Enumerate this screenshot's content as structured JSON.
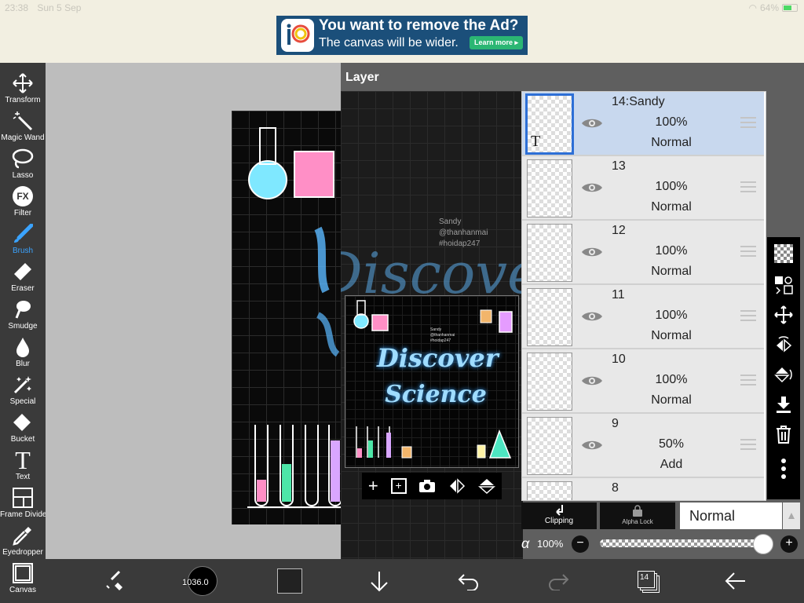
{
  "status": {
    "time": "23:38",
    "date": "Sun 5 Sep",
    "battery": "64%"
  },
  "ad": {
    "line1": "You want to remove the Ad?",
    "line2": "The canvas will be wider.",
    "button": "Learn more ▸"
  },
  "tools": [
    {
      "label": "Transform"
    },
    {
      "label": "Magic Wand"
    },
    {
      "label": "Lasso"
    },
    {
      "label": "Filter"
    },
    {
      "label": "Brush"
    },
    {
      "label": "Eraser"
    },
    {
      "label": "Smudge"
    },
    {
      "label": "Blur"
    },
    {
      "label": "Special"
    },
    {
      "label": "Bucket"
    },
    {
      "label": "Text"
    },
    {
      "label": "Frame Divider"
    },
    {
      "label": "Eyedropper"
    },
    {
      "label": "Canvas"
    }
  ],
  "filter_icon_text": "FX",
  "text_icon_text": "T",
  "layer_panel": {
    "title": "Layer"
  },
  "art_text": {
    "credit1": "Sandy",
    "credit2": "@thanhanmai",
    "credit3": "#hoidap247",
    "word1": "Discover",
    "word2": "Science"
  },
  "layers": [
    {
      "name": "14:Sandy",
      "opacity": "100%",
      "mode": "Normal",
      "selected": true
    },
    {
      "name": "13",
      "opacity": "100%",
      "mode": "Normal"
    },
    {
      "name": "12",
      "opacity": "100%",
      "mode": "Normal"
    },
    {
      "name": "11",
      "opacity": "100%",
      "mode": "Normal"
    },
    {
      "name": "10",
      "opacity": "100%",
      "mode": "Normal"
    },
    {
      "name": "9",
      "opacity": "50%",
      "mode": "Add"
    },
    {
      "name": "8"
    }
  ],
  "layer_thumb_letter": "T",
  "clipping_label": "Clipping",
  "alpha_lock_label": "Alpha Lock",
  "blend_mode": "Normal",
  "alpha": {
    "symbol": "α",
    "value": "100%"
  },
  "bottom": {
    "brush_size": "1036.0",
    "layer_count": "14"
  },
  "colors": {
    "accent": "#3aa3ff",
    "toolbar": "#3a3a3a",
    "selected_layer": "#c8d8ee",
    "ad_bg": "#1b4f7a"
  }
}
